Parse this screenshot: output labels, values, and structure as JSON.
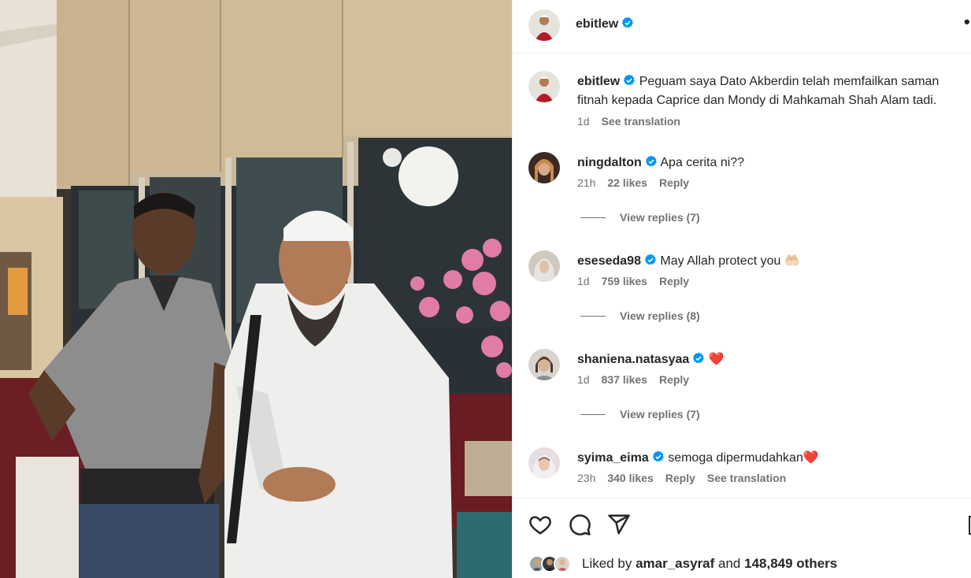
{
  "post": {
    "author": "ebitlew",
    "more_label": "•"
  },
  "caption": {
    "username": "ebitlew",
    "text": "Peguam saya Dato Akberdin telah memfailkan saman fitnah kepada Caprice dan Mondy di Mahkamah Shah Alam tadi.",
    "time": "1d",
    "translate": "See translation"
  },
  "comments": [
    {
      "username": "ningdalton",
      "text": "Apa cerita ni??",
      "time": "21h",
      "likes": "22 likes",
      "reply": "Reply",
      "view_replies": "View replies (7)"
    },
    {
      "username": "eseseda98",
      "text": "May Allah protect you 🤲🏻",
      "time": "1d",
      "likes": "759 likes",
      "reply": "Reply",
      "view_replies": "View replies (8)"
    },
    {
      "username": "shaniena.natasyaa",
      "text": "❤️",
      "time": "1d",
      "likes": "837 likes",
      "reply": "Reply",
      "view_replies": "View replies (7)"
    },
    {
      "username": "syima_eima",
      "text": "semoga dipermudahkan❤️",
      "time": "23h",
      "likes": "340 likes",
      "reply": "Reply",
      "translate": "See translation"
    }
  ],
  "likes": {
    "prefix": "Liked by",
    "user": "amar_asyraf",
    "conjunction": "and",
    "count": "148,849 others"
  },
  "icons": {
    "like": "heart-icon",
    "comment": "comment-bubble-icon",
    "share": "paper-plane-icon",
    "save": "bookmark-icon",
    "verified": "verified-badge-icon"
  },
  "colors": {
    "verified": "#0095f6",
    "text": "#262626",
    "muted": "#737373",
    "heart_red": "#e0245e"
  }
}
